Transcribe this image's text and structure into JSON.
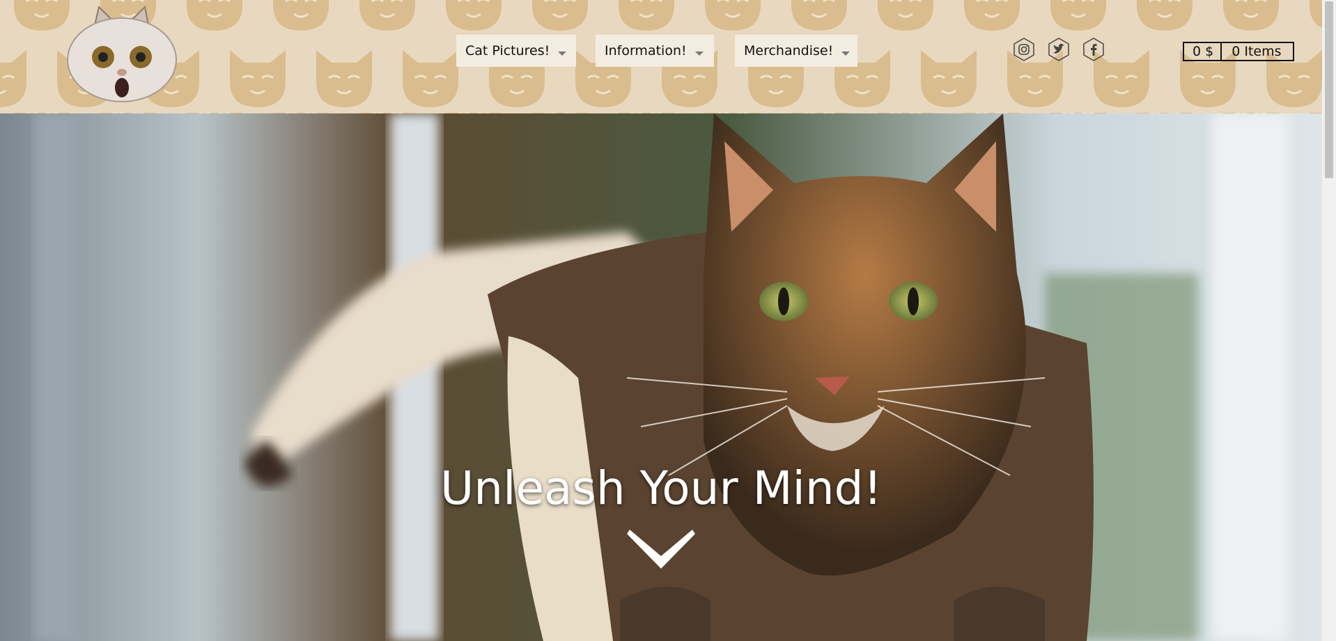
{
  "header": {
    "nav": [
      {
        "label": "Cat Pictures!"
      },
      {
        "label": "Information!"
      },
      {
        "label": "Merchandise!"
      }
    ],
    "social": [
      "instagram-icon",
      "twitter-icon",
      "facebook-icon"
    ],
    "cart": {
      "price": "0 $",
      "items": "0 Items"
    }
  },
  "hero": {
    "title": "Unleash Your Mind!"
  },
  "colors": {
    "header_bg": "#e8d8bf",
    "pattern_cat": "#d9bd8e",
    "nav_bg": "#f3ece1"
  }
}
